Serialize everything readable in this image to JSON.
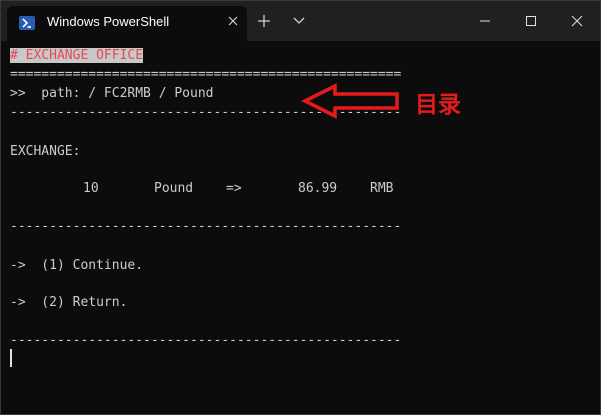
{
  "window": {
    "tab_title": "Windows PowerShell",
    "icons": [
      "powershell-icon",
      "close-icon",
      "plus-icon",
      "chevron-down-icon",
      "minimize-icon",
      "maximize-icon",
      "close-icon"
    ]
  },
  "terminal": {
    "header": "# EXCHANGE OFFICE",
    "rule_double": "==================================================",
    "path_line": ">>  path: / FC2RMB / Pound",
    "rule_single": "--------------------------------------------------",
    "section_label": "EXCHANGE:",
    "exchange": {
      "amount": "10",
      "from_currency": "Pound",
      "arrow": "=>",
      "result": "86.99",
      "to_currency": "RMB"
    },
    "options": [
      "->  (1) Continue.",
      "->  (2) Return."
    ]
  },
  "annotation": {
    "label": "目录",
    "color": "#e51b1b"
  },
  "colors": {
    "background": "#0c0c0c",
    "titlebar": "#202020",
    "text": "#cccccc",
    "header_text": "#e74856",
    "header_highlight": "#c8c8c8"
  }
}
